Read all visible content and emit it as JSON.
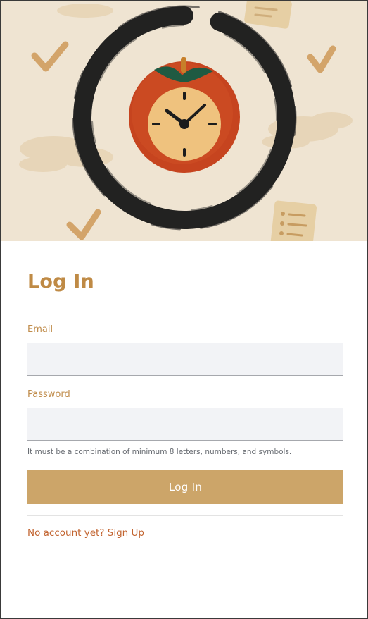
{
  "login": {
    "title": "Log In",
    "email": {
      "label": "Email",
      "value": "",
      "placeholder": ""
    },
    "password": {
      "label": "Password",
      "value": "",
      "placeholder": ""
    },
    "password_hint": "It must be a combination of minimum 8 letters, numbers, and symbols.",
    "submit_label": "Log In",
    "no_account_text": "No account yet?",
    "signup_link": "Sign Up"
  },
  "colors": {
    "hero_background": "#efe4d2",
    "title": "#bf8a45",
    "button": "#cca569",
    "link": "#c26430"
  }
}
